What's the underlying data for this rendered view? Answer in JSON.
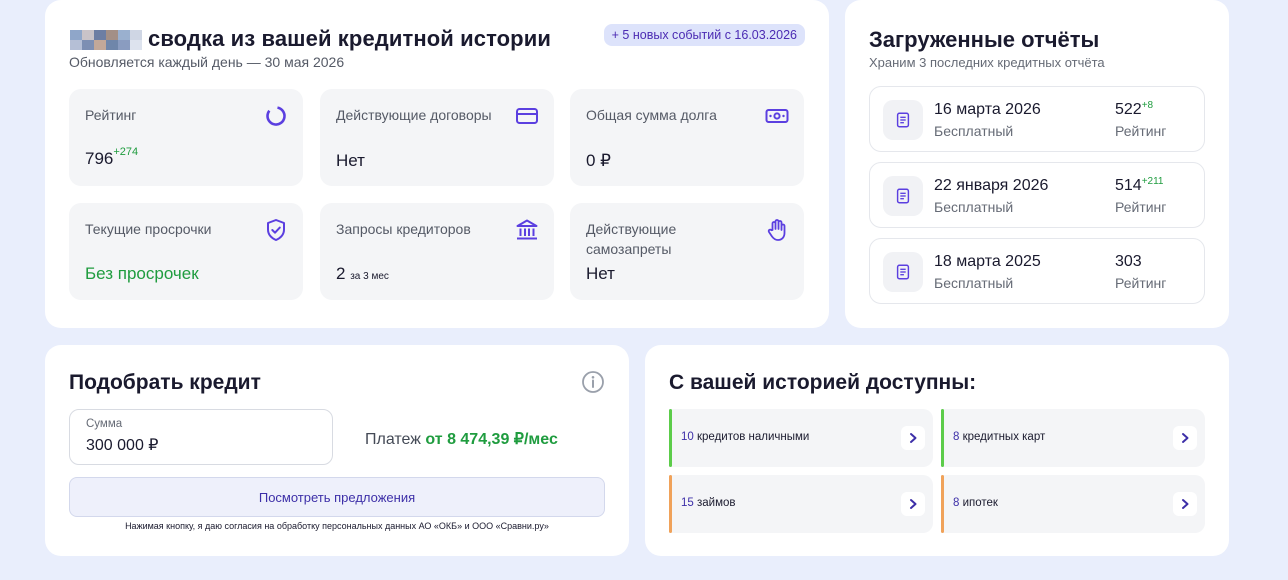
{
  "summary": {
    "title": "сводка из вашей кредитной истории",
    "subtitle": "Обновляется каждый день — 30 мая 2026",
    "events_badge": "+ 5 новых событий с 16.03.2026",
    "pixel_colors": [
      "#8fa6c9",
      "#c9c3c8",
      "#6d7ea3",
      "#a38f86",
      "#9ab0cf",
      "#cfd6e4",
      "#b5bfd6",
      "#7d8fb3",
      "#c2a899",
      "#6f86aa",
      "#8a9cc0",
      "#dde3ee"
    ],
    "tiles": {
      "rating": {
        "label": "Рейтинг",
        "value": "796",
        "delta": "+274",
        "icon": "rating-ring-icon"
      },
      "contracts": {
        "label": "Действующие договоры",
        "value": "Нет",
        "icon": "card-icon"
      },
      "debt": {
        "label": "Общая сумма долга",
        "value": "0 ₽",
        "icon": "cash-icon"
      },
      "overdue": {
        "label": "Текущие просрочки",
        "value": "Без просрочек",
        "icon": "shield-check-icon"
      },
      "requests": {
        "label": "Запросы кредиторов",
        "value": "2",
        "note": "за 3 мес",
        "icon": "bank-icon"
      },
      "bans": {
        "label": "Действующие самозапреты",
        "value": "Нет",
        "icon": "hand-stop-icon"
      }
    }
  },
  "reports": {
    "title": "Загруженные отчёты",
    "subtitle": "Храним 3 последних кредитных отчёта",
    "items": [
      {
        "date": "16 марта 2026",
        "type": "Бесплатный",
        "score": "522",
        "delta": "+8",
        "score_label": "Рейтинг"
      },
      {
        "date": "22 января 2026",
        "type": "Бесплатный",
        "score": "514",
        "delta": "+211",
        "score_label": "Рейтинг"
      },
      {
        "date": "18 марта 2025",
        "type": "Бесплатный",
        "score": "303",
        "delta": "",
        "score_label": "Рейтинг"
      }
    ]
  },
  "credit": {
    "title": "Подобрать кредит",
    "amount_label": "Сумма",
    "amount_value": "300 000 ₽",
    "payment_label": "Платеж",
    "payment_value": "от 8 474,39 ₽/мес",
    "button": "Посмотреть предложения",
    "consent": "Нажимая кнопку, я даю согласия на обработку персональных данных АО «ОКБ» и ООО «Сравни.ру»"
  },
  "offers": {
    "title": "С вашей историей доступны:",
    "items": [
      {
        "count": "10",
        "label": "кредитов наличными",
        "color": "#5ccc4a"
      },
      {
        "count": "8",
        "label": "кредитных карт",
        "color": "#5ccc4a"
      },
      {
        "count": "15",
        "label": "займов",
        "color": "#f0a25a"
      },
      {
        "count": "8",
        "label": "ипотек",
        "color": "#f0a25a"
      }
    ]
  },
  "colors": {
    "accent": "#5b3fe0",
    "green": "#1f9c3f",
    "background": "#e9eefc"
  }
}
